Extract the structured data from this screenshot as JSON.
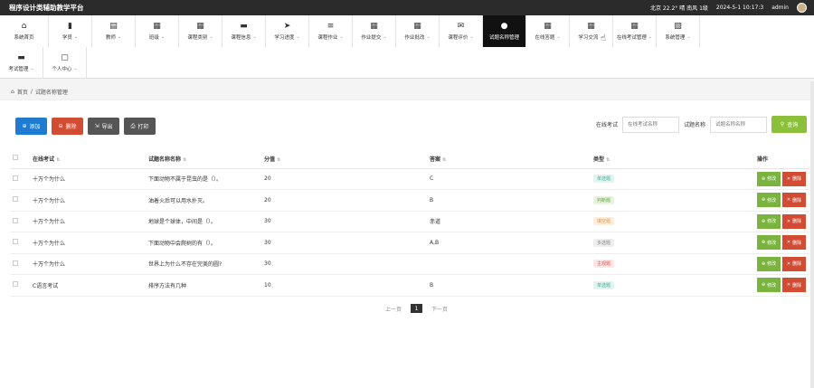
{
  "app": {
    "title": "程序设计类辅助教学平台"
  },
  "status": {
    "city": "北京",
    "temp": "22.2°",
    "weather": "晴",
    "wind": "南风",
    "level": "1级",
    "datetime": "2024-5-1 10:17:3",
    "user": "admin"
  },
  "nav_row1": [
    {
      "icon": "⌂",
      "label": "系统首页",
      "name": "home"
    },
    {
      "icon": "▮",
      "label": "学员",
      "name": "student",
      "caret": "⌄"
    },
    {
      "icon": "▤",
      "label": "教师",
      "name": "teacher",
      "caret": "⌄"
    },
    {
      "icon": "▦",
      "label": "班级",
      "name": "class",
      "caret": "⌄"
    },
    {
      "icon": "▦",
      "label": "课程类别",
      "name": "course-category",
      "caret": "⌄"
    },
    {
      "icon": "▬",
      "label": "课程信息",
      "name": "course-info",
      "caret": "⌄"
    },
    {
      "icon": "➤",
      "label": "学习进度",
      "name": "learning-progress",
      "caret": "⌄"
    },
    {
      "icon": "≡",
      "label": "课程作业",
      "name": "course-homework",
      "caret": "⌄"
    },
    {
      "icon": "▦",
      "label": "作业提交",
      "name": "homework-submit",
      "caret": "⌄"
    },
    {
      "icon": "▦",
      "label": "作业批改",
      "name": "homework-grade",
      "caret": "⌄"
    },
    {
      "icon": "✉",
      "label": "课程评价",
      "name": "course-review",
      "caret": "⌄"
    },
    {
      "icon": "●",
      "label": "试题名称管理",
      "name": "question-manage",
      "active": true
    },
    {
      "icon": "▦",
      "label": "在线答题",
      "name": "online-answer",
      "caret": "⌄"
    },
    {
      "icon": "▦",
      "label": "学习交流",
      "name": "learning-exchange",
      "caret": "⌄"
    },
    {
      "icon": "▦",
      "label": "在线考试管理",
      "name": "exam-manage",
      "caret": "⌄"
    },
    {
      "icon": "▧",
      "label": "系统管理",
      "name": "system-manage",
      "caret": "⌄"
    }
  ],
  "nav_row2": [
    {
      "icon": "▬",
      "label": "考试管理",
      "name": "exam-admin",
      "caret": "⌄"
    },
    {
      "icon": "▢",
      "label": "个人中心",
      "name": "personal-center",
      "caret": "⌄"
    }
  ],
  "breadcrumb": {
    "home": "首页",
    "sep": "/",
    "current": "试题名称管理"
  },
  "toolbar": {
    "add": "添加",
    "delete": "删除",
    "export": "导出",
    "print": "打印"
  },
  "search": {
    "exam_label": "在线考试",
    "exam_placeholder": "在线考试名称",
    "question_label": "试题名称",
    "question_placeholder": "试题名称名称",
    "button": "查询"
  },
  "table": {
    "headers": [
      "在线考试",
      "试题名称名称",
      "分值",
      "答案",
      "类型",
      "操作"
    ],
    "rows": [
      {
        "exam": "十万个为什么",
        "question": "下面动物不属于昆虫的是（）。",
        "score": "20",
        "answer": "C",
        "type": "单选题",
        "type_bg": "#e2f4ee",
        "type_color": "#4a9"
      },
      {
        "exam": "十万个为什么",
        "question": "油着火后可以用水扑灭。",
        "score": "20",
        "answer": "B",
        "type": "判断题",
        "type_bg": "#e8f4e0",
        "type_color": "#6a4"
      },
      {
        "exam": "十万个为什么",
        "question": "地球是个球体，中间是（）。",
        "score": "30",
        "answer": "赤道",
        "type": "填空题",
        "type_bg": "#fbeede",
        "type_color": "#d94"
      },
      {
        "exam": "十万个为什么",
        "question": "下面动物中会爬树的有（）。",
        "score": "30",
        "answer": "A,B",
        "type": "多选题",
        "type_bg": "#eeeeee",
        "type_color": "#888"
      },
      {
        "exam": "十万个为什么",
        "question": "世界上为什么不存在完美的圆?",
        "score": "30",
        "answer": "",
        "type": "主观题",
        "type_bg": "#fde6e6",
        "type_color": "#d55"
      },
      {
        "exam": "C语言考试",
        "question": "排序方法有几种",
        "score": "10",
        "answer": "B",
        "type": "单选题",
        "type_bg": "#e2f4ee",
        "type_color": "#4a9"
      }
    ],
    "edit_label": "修改",
    "delete_label": "删除"
  },
  "pager": {
    "prev": "上一页",
    "current": "1",
    "next": "下一页"
  }
}
